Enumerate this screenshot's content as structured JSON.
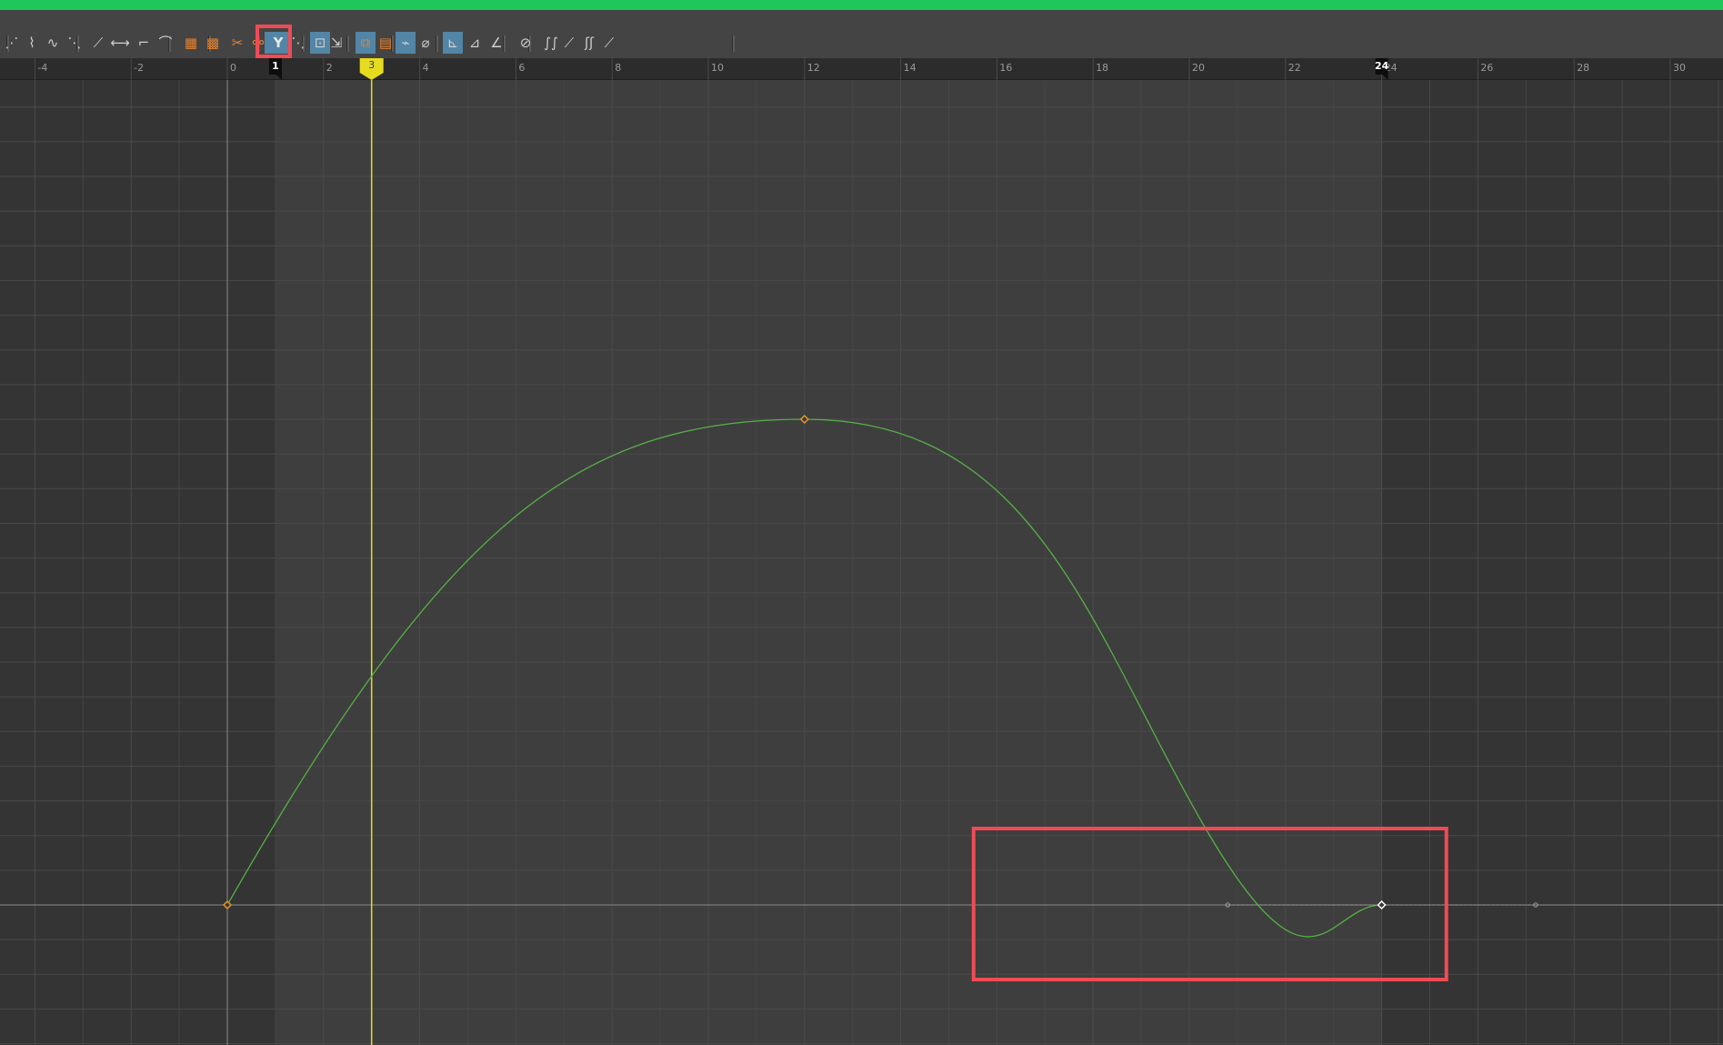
{
  "toolbar": {
    "items": [
      {
        "name": "key-stats-icon",
        "glyph": "⋰"
      },
      {
        "name": "tangent-auto-icon",
        "glyph": "⌇"
      },
      {
        "name": "tangent-spline-icon",
        "glyph": "∿"
      },
      {
        "name": "tangent-clamped-icon",
        "glyph": "⋱"
      },
      {
        "name": "tangent-linear-icon",
        "glyph": "⟋"
      },
      {
        "name": "tangent-flat-icon",
        "glyph": "⟷"
      },
      {
        "name": "tangent-step-icon",
        "glyph": "⌐"
      },
      {
        "name": "tangent-plateau-icon",
        "glyph": "⌒"
      },
      {
        "name": "buffer-curve-snapshot-icon",
        "glyph": "▦"
      },
      {
        "name": "swap-buffer-curve-icon",
        "glyph": "▩"
      },
      {
        "name": "break-tangents-icon",
        "glyph": "✂"
      },
      {
        "name": "unify-tangents-icon",
        "glyph": "⚯"
      },
      {
        "name": "free-tangent-weight-icon",
        "glyph": "Y"
      },
      {
        "name": "lock-tangent-weight-icon",
        "glyph": "⋱"
      },
      {
        "name": "auto-load-selection-icon",
        "glyph": "⊡"
      },
      {
        "name": "load-selected-icon",
        "glyph": "⇲"
      },
      {
        "name": "time-snap-icon",
        "glyph": "⧉"
      },
      {
        "name": "value-snap-icon",
        "glyph": "▤"
      },
      {
        "name": "normalize-curves-icon",
        "glyph": "⌁"
      },
      {
        "name": "denormalize-curves-icon",
        "glyph": "⌀"
      },
      {
        "name": "pre-infinity-cycle-icon",
        "glyph": "⊾"
      },
      {
        "name": "post-infinity-cycle-icon",
        "glyph": "⊿"
      },
      {
        "name": "cycle-offset-icon",
        "glyph": "∠"
      },
      {
        "name": "isolate-curve-icon",
        "glyph": "⊘"
      },
      {
        "name": "stacked-curves-icon",
        "glyph": "∫∫"
      },
      {
        "name": "show-tangents-icon",
        "glyph": "⟋"
      },
      {
        "name": "curve-view-icon",
        "glyph": "ʃʃ"
      },
      {
        "name": "curve-options-icon",
        "glyph": "⟋"
      }
    ]
  },
  "timeline": {
    "tick_labels": [
      "-4",
      "-2",
      "0",
      "2",
      "4",
      "6",
      "8",
      "10",
      "12",
      "14",
      "16",
      "18",
      "20",
      "22",
      "24",
      "26",
      "28",
      "30"
    ],
    "range_start_label": "1",
    "range_end_label": "24",
    "current_frame_label": "3"
  },
  "colors": {
    "curve": "#56b046",
    "playhead": "#e6dc1e",
    "keyframe": "#e8962a",
    "selected_key": "#ffffff",
    "highlight_box": "#f04b55",
    "active_button": "#5285a6"
  },
  "chart_data": {
    "type": "line",
    "x_range": [
      -4.5,
      31
    ],
    "current_frame": 3,
    "playback_range": [
      1,
      24
    ],
    "keyframes": [
      {
        "frame": 0,
        "value": 0,
        "selected": false
      },
      {
        "frame": 12,
        "value": 1,
        "selected": false
      },
      {
        "frame": 24,
        "value": 0,
        "selected": true
      }
    ],
    "selected_key_tangent": {
      "in_frame": 20.8,
      "out_frame": 27.2,
      "value": 0
    }
  }
}
